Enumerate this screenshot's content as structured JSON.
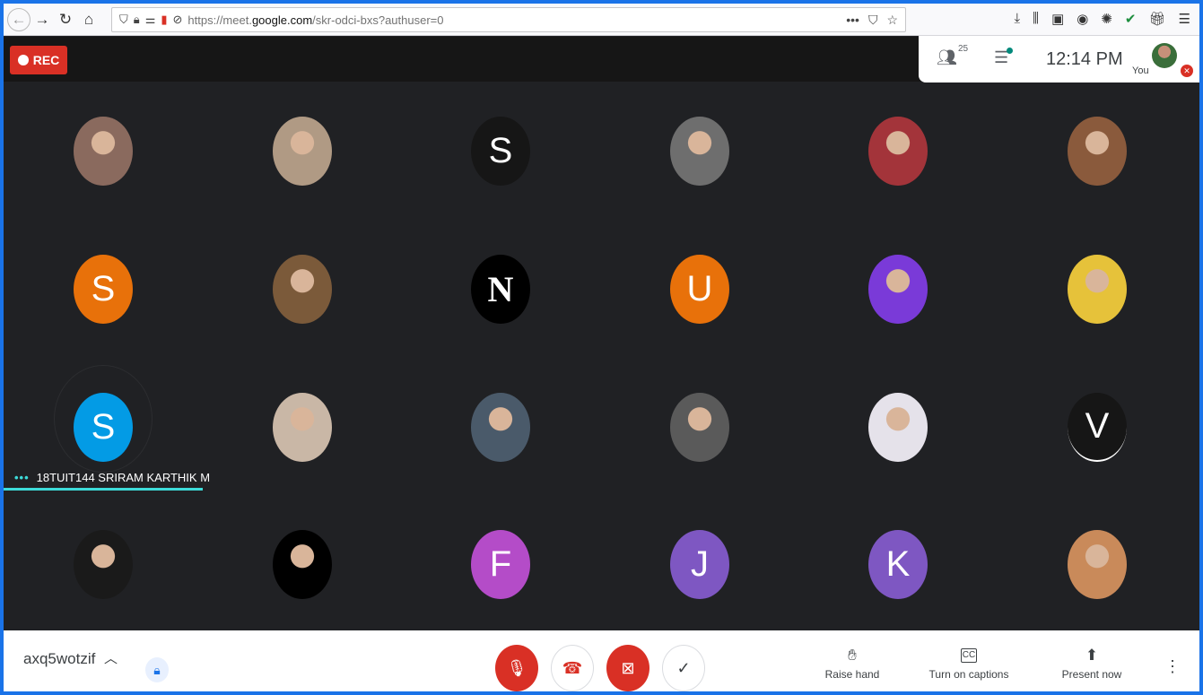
{
  "browser": {
    "url_prefix": "https://meet.",
    "url_domain": "google.com",
    "url_path": "/skr-odci-bxs?authuser=0",
    "icons": [
      "back-icon",
      "forward-icon",
      "reload-icon",
      "home-icon",
      "shield-icon",
      "lock-icon",
      "permissions-icon",
      "mic-indicator-icon",
      "camera-blocked-icon",
      "page-actions-icon",
      "pocket-icon",
      "bookmark-star-icon",
      "download-icon",
      "library-icon",
      "sidebar-icon",
      "account-icon",
      "extension-icon",
      "check-extension-icon",
      "gift-icon",
      "menu-icon"
    ],
    "page_actions": "•••"
  },
  "meet_top": {
    "rec_label": "REC",
    "people_count": "25",
    "clock": "12:14 PM",
    "you_label": "You"
  },
  "participants": [
    {
      "initial": "",
      "kind": "photo",
      "color": "#8a6a5e"
    },
    {
      "initial": "",
      "kind": "photo",
      "color": "#b09a84"
    },
    {
      "initial": "S",
      "kind": "letter",
      "color": "#161616"
    },
    {
      "initial": "",
      "kind": "photo",
      "color": "#6e6e6e"
    },
    {
      "initial": "",
      "kind": "photo",
      "color": "#a3343a"
    },
    {
      "initial": "",
      "kind": "photo",
      "color": "#8a5a3c"
    },
    {
      "initial": "S",
      "kind": "letter",
      "color": "#e8710a"
    },
    {
      "initial": "",
      "kind": "photo",
      "color": "#7b5a3a"
    },
    {
      "initial": "N",
      "kind": "logo",
      "color": "#000000"
    },
    {
      "initial": "U",
      "kind": "letter",
      "color": "#e8710a"
    },
    {
      "initial": "",
      "kind": "photo",
      "color": "#7a3ad8"
    },
    {
      "initial": "",
      "kind": "photo",
      "color": "#e6c23a"
    },
    {
      "initial": "S",
      "kind": "letter",
      "color": "#039be5"
    },
    {
      "initial": "",
      "kind": "photo",
      "color": "#c9b7a6"
    },
    {
      "initial": "",
      "kind": "photo",
      "color": "#4a5a6a"
    },
    {
      "initial": "",
      "kind": "photo",
      "color": "#5a5a5a"
    },
    {
      "initial": "",
      "kind": "photo",
      "color": "#e5e2ea"
    },
    {
      "initial": "V",
      "kind": "letter",
      "color": "#161616"
    },
    {
      "initial": "",
      "kind": "photo",
      "color": "#1a1a1a"
    },
    {
      "initial": "",
      "kind": "photo",
      "color": "#000000"
    },
    {
      "initial": "F",
      "kind": "letter",
      "color": "#b44cc8"
    },
    {
      "initial": "J",
      "kind": "letter",
      "color": "#7e57c2"
    },
    {
      "initial": "K",
      "kind": "letter",
      "color": "#7e57c2"
    },
    {
      "initial": "",
      "kind": "photo",
      "color": "#c98a5a"
    }
  ],
  "speaker": {
    "dots": "•••",
    "name": "18TUIT144 SRIRAM KARTHIK M"
  },
  "bottom": {
    "meeting_code": "axq5wotzif",
    "raise_hand": "Raise hand",
    "captions": "Turn on captions",
    "captions_icon_text": "CC",
    "present": "Present now"
  }
}
